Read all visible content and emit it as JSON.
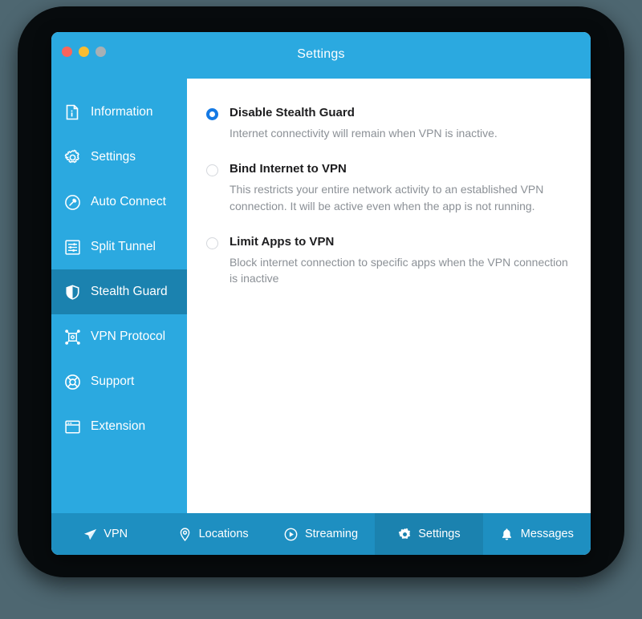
{
  "window": {
    "title": "Settings",
    "traffic_lights": [
      {
        "name": "close",
        "color": "#f9655b"
      },
      {
        "name": "minimize",
        "color": "#f9bd30"
      },
      {
        "name": "maximize",
        "color": "#a7b0b5"
      }
    ]
  },
  "colors": {
    "brand_blue": "#2BA9E0",
    "brand_blue_dark": "#1B82AF",
    "tabbar_blue": "#1E8FC1",
    "radio_selected": "#1479e4",
    "desc_gray": "#8b9096",
    "page_background": "#4e6771",
    "device_frame": "#070b0d"
  },
  "sidebar": {
    "items": [
      {
        "label": "Information",
        "icon": "document-info-icon",
        "active": false
      },
      {
        "label": "Settings",
        "icon": "gear-icon",
        "active": false
      },
      {
        "label": "Auto Connect",
        "icon": "auto-connect-icon",
        "active": false
      },
      {
        "label": "Split Tunnel",
        "icon": "sliders-box-icon",
        "active": false
      },
      {
        "label": "Stealth Guard",
        "icon": "shield-icon",
        "active": true
      },
      {
        "label": "VPN Protocol",
        "icon": "network-nodes-icon",
        "active": false
      },
      {
        "label": "Support",
        "icon": "lifebuoy-icon",
        "active": false
      },
      {
        "label": "Extension",
        "icon": "browser-window-icon",
        "active": false
      }
    ]
  },
  "content": {
    "options": [
      {
        "title": "Disable Stealth Guard",
        "description": "Internet connectivity will remain when VPN is inactive.",
        "selected": true
      },
      {
        "title": "Bind Internet to VPN",
        "description": "This restricts your entire network activity to an established VPN connection. It will be active even when the app is not running.",
        "selected": false
      },
      {
        "title": "Limit Apps to VPN",
        "description": "Block internet connection to specific apps when the VPN connection is inactive",
        "selected": false
      }
    ]
  },
  "tabbar": {
    "items": [
      {
        "label": "VPN",
        "icon": "paper-plane-icon",
        "active": false
      },
      {
        "label": "Locations",
        "icon": "map-pin-icon",
        "active": false
      },
      {
        "label": "Streaming",
        "icon": "play-circle-icon",
        "active": false
      },
      {
        "label": "Settings",
        "icon": "gear-icon",
        "active": true
      },
      {
        "label": "Messages",
        "icon": "bell-icon",
        "active": false
      }
    ]
  }
}
